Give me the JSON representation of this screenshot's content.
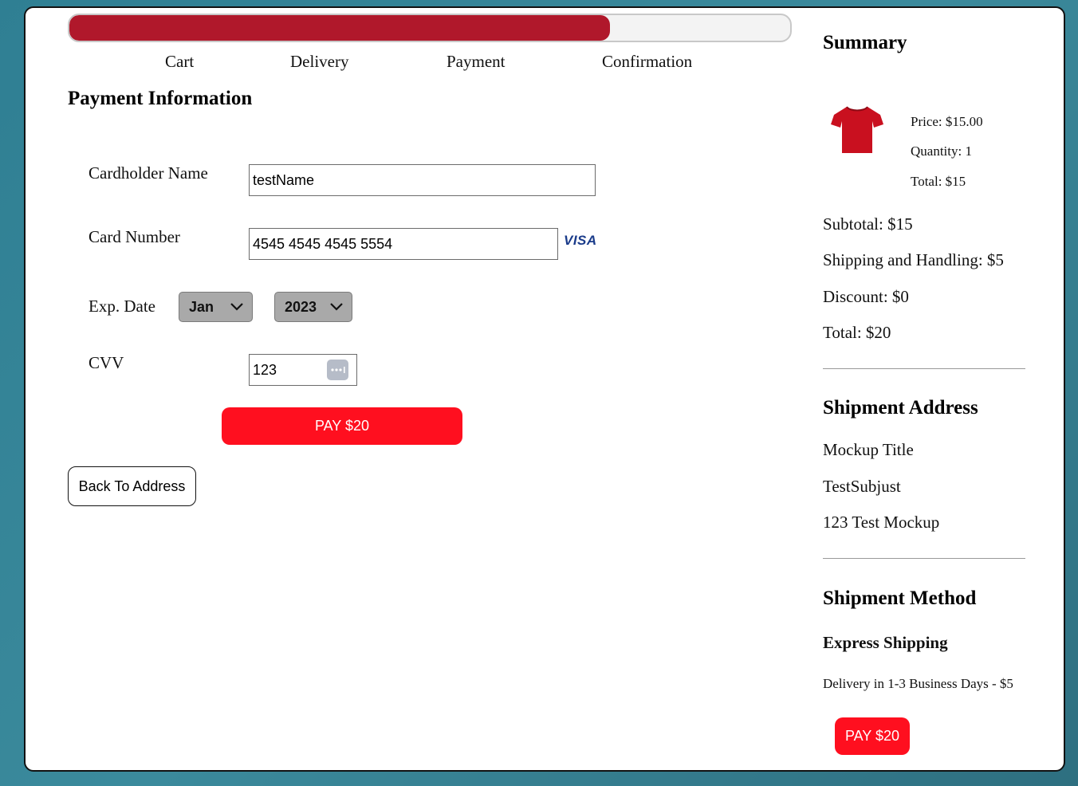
{
  "progress": {
    "fraction": 0.75
  },
  "steps": [
    "Cart",
    "Delivery",
    "Payment",
    "Confirmation"
  ],
  "payment": {
    "title": "Payment Information",
    "cardholder_label": "Cardholder Name",
    "cardholder_value": "testName",
    "card_number_label": "Card Number",
    "card_number_value": "4545 4545 4545 5554",
    "card_brand": "VISA",
    "exp_label": "Exp. Date",
    "exp_month": "Jan",
    "exp_year": "2023",
    "cvv_label": "CVV",
    "cvv_value": "123",
    "pay_label": "PAY $20",
    "back_label": "Back To Address"
  },
  "summary": {
    "title": "Summary",
    "item": {
      "icon": "red-tshirt-image",
      "price": "Price: $15.00",
      "quantity": "Quantity: 1",
      "total": "Total: $15"
    },
    "subtotal": "Subtotal: $15",
    "shipping": "Shipping and Handling: $5",
    "discount": "Discount: $0",
    "total": "Total: $20"
  },
  "address": {
    "title": "Shipment Address",
    "lines": [
      "Mockup Title",
      "TestSubjust",
      "123 Test Mockup"
    ]
  },
  "method": {
    "title": "Shipment Method",
    "name": "Express Shipping",
    "detail": "Delivery in 1-3 Business Days - $5",
    "pay_label": "PAY $20"
  },
  "colors": {
    "accent": "#ff0f1f",
    "progress": "#b0182b",
    "background": "#2f7f93"
  }
}
